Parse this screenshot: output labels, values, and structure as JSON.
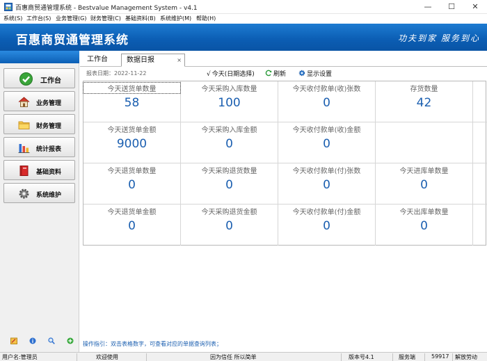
{
  "window": {
    "title": "百惠商贸通管理系统 - Bestvalue Management System - v4.1",
    "minimize": "—",
    "maximize": "☐",
    "close": "✕"
  },
  "menu": [
    "系统(S)",
    "工作台(S)",
    "业务管理(G)",
    "财务管理(C)",
    "基础资料(B)",
    "系统维护(M)",
    "帮助(H)"
  ],
  "banner": {
    "app_title": "百惠商贸通管理系统",
    "slogan": "功夫到家 服务到心"
  },
  "sidebar": {
    "items": [
      {
        "label": "工作台",
        "icon": "check-circle-icon"
      },
      {
        "label": "业务管理",
        "icon": "house-icon"
      },
      {
        "label": "财务管理",
        "icon": "folder-icon"
      },
      {
        "label": "统计报表",
        "icon": "bar-chart-icon"
      },
      {
        "label": "基础资料",
        "icon": "book-icon"
      },
      {
        "label": "系统维护",
        "icon": "gear-icon"
      }
    ],
    "bottom_icons": [
      "edit-icon",
      "info-icon",
      "search-icon",
      "add-icon"
    ]
  },
  "tabs": [
    {
      "label": "工作台",
      "active": false
    },
    {
      "label": "数据日报",
      "active": true,
      "close": "×"
    }
  ],
  "toolbar": {
    "report_date": "报表日期：2022-11-22",
    "today_button": "今天(日期选择)",
    "refresh_button": "刷新",
    "display_settings_button": "显示设置"
  },
  "stats": [
    [
      {
        "label": "今天送货单数量",
        "value": "58"
      },
      {
        "label": "今天采购入库数量",
        "value": "100"
      },
      {
        "label": "今天收付款单(收)张数",
        "value": "0"
      },
      {
        "label": "存货数量",
        "value": "42"
      }
    ],
    [
      {
        "label": "今天送货单金额",
        "value": "9000"
      },
      {
        "label": "今天采购入库金额",
        "value": "0"
      },
      {
        "label": "今天收付款单(收)金额",
        "value": "0"
      },
      {
        "label": "",
        "value": ""
      }
    ],
    [
      {
        "label": "今天退货单数量",
        "value": "0"
      },
      {
        "label": "今天采购退货数量",
        "value": "0"
      },
      {
        "label": "今天收付款单(付)张数",
        "value": "0"
      },
      {
        "label": "今天进库单数量",
        "value": "0"
      }
    ],
    [
      {
        "label": "今天退货单金额",
        "value": "0"
      },
      {
        "label": "今天采购退货金额",
        "value": "0"
      },
      {
        "label": "今天收付款单(付)金额",
        "value": "0"
      },
      {
        "label": "今天出库单数量",
        "value": "0"
      }
    ]
  ],
  "guide_text": "操作指引：双击表格数字，可查看对应的单据查询列表；",
  "statusbar": {
    "user": "用户名:管理员",
    "welcome": "欢迎使用",
    "motto": "因为信任 所以简单",
    "version": "版本号4.1",
    "server": "服务端",
    "port": "59917",
    "labor": "解放劳动"
  },
  "colors": {
    "banner": "#0b5db3",
    "value_blue": "#1b5fb0",
    "label_gray": "#666666"
  }
}
